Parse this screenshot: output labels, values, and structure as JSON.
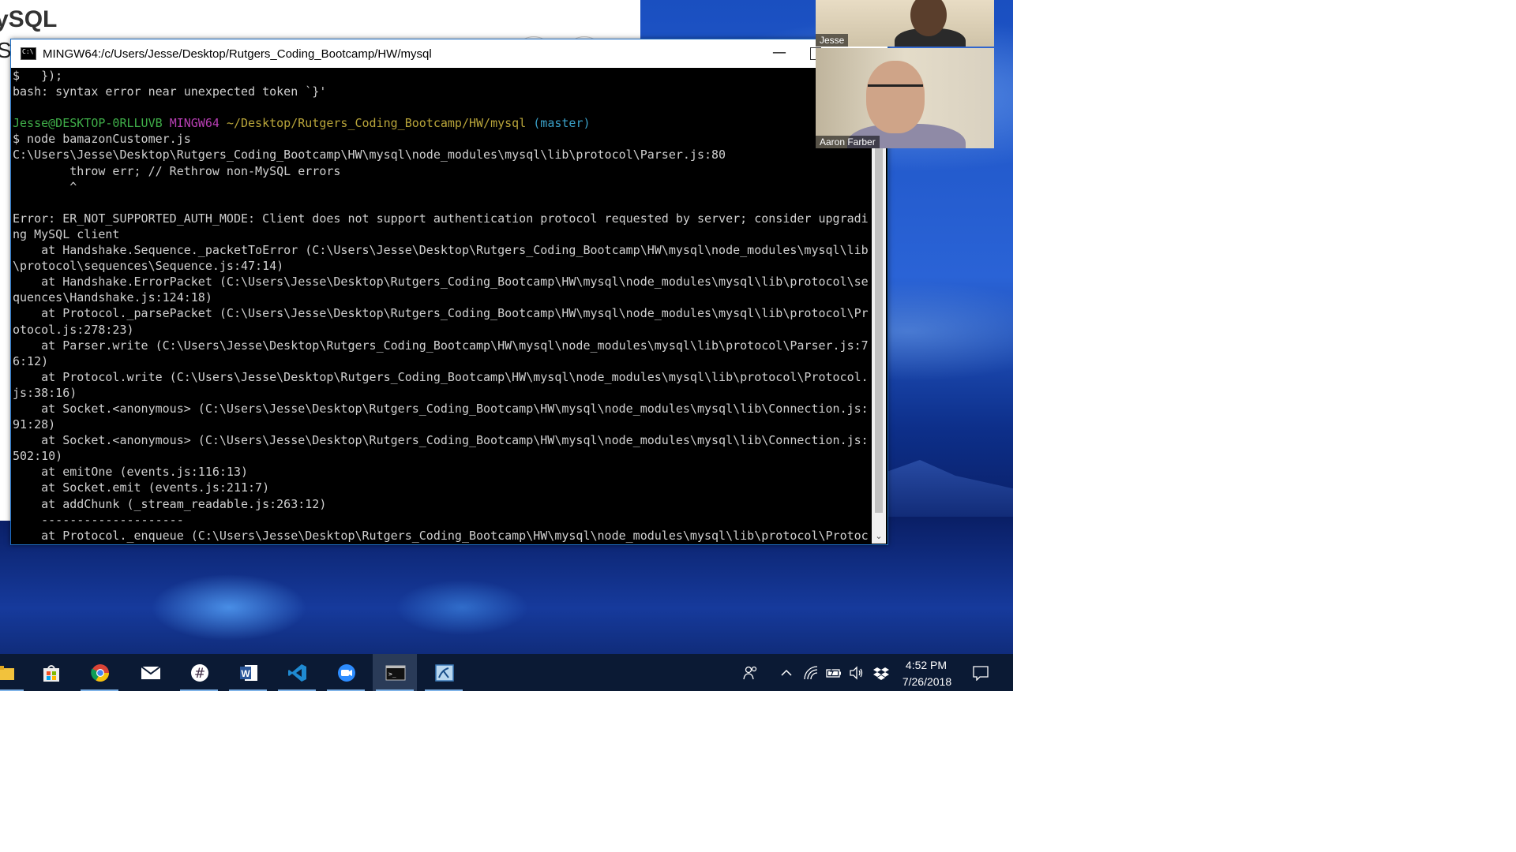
{
  "background_window": {
    "logo_text": "ySQL",
    "second_text": "S"
  },
  "terminal": {
    "title": "MINGW64:/c/Users/Jesse/Desktop/Rutgers_Coding_Bootcamp/HW/mysql",
    "minimize_glyph": "—",
    "prompt": {
      "user_host": "Jesse@DESKTOP-0RLLUVB",
      "system": "MINGW64",
      "path": "~/Desktop/Rutgers_Coding_Bootcamp/HW/mysql",
      "branch": "(master)"
    },
    "lines_before_prompt": [
      "$   });",
      "bash: syntax error near unexpected token `}'",
      ""
    ],
    "lines_after_prompt": [
      "$ node bamazonCustomer.js",
      "C:\\Users\\Jesse\\Desktop\\Rutgers_Coding_Bootcamp\\HW\\mysql\\node_modules\\mysql\\lib\\protocol\\Parser.js:80",
      "        throw err; // Rethrow non-MySQL errors",
      "        ^",
      "",
      "Error: ER_NOT_SUPPORTED_AUTH_MODE: Client does not support authentication protocol requested by server; consider upgradi",
      "ng MySQL client",
      "    at Handshake.Sequence._packetToError (C:\\Users\\Jesse\\Desktop\\Rutgers_Coding_Bootcamp\\HW\\mysql\\node_modules\\mysql\\lib",
      "\\protocol\\sequences\\Sequence.js:47:14)",
      "    at Handshake.ErrorPacket (C:\\Users\\Jesse\\Desktop\\Rutgers_Coding_Bootcamp\\HW\\mysql\\node_modules\\mysql\\lib\\protocol\\se",
      "quences\\Handshake.js:124:18)",
      "    at Protocol._parsePacket (C:\\Users\\Jesse\\Desktop\\Rutgers_Coding_Bootcamp\\HW\\mysql\\node_modules\\mysql\\lib\\protocol\\Pr",
      "otocol.js:278:23)",
      "    at Parser.write (C:\\Users\\Jesse\\Desktop\\Rutgers_Coding_Bootcamp\\HW\\mysql\\node_modules\\mysql\\lib\\protocol\\Parser.js:7",
      "6:12)",
      "    at Protocol.write (C:\\Users\\Jesse\\Desktop\\Rutgers_Coding_Bootcamp\\HW\\mysql\\node_modules\\mysql\\lib\\protocol\\Protocol.",
      "js:38:16)",
      "    at Socket.<anonymous> (C:\\Users\\Jesse\\Desktop\\Rutgers_Coding_Bootcamp\\HW\\mysql\\node_modules\\mysql\\lib\\Connection.js:",
      "91:28)",
      "    at Socket.<anonymous> (C:\\Users\\Jesse\\Desktop\\Rutgers_Coding_Bootcamp\\HW\\mysql\\node_modules\\mysql\\lib\\Connection.js:",
      "502:10)",
      "    at emitOne (events.js:116:13)",
      "    at Socket.emit (events.js:211:7)",
      "    at addChunk (_stream_readable.js:263:12)",
      "    --------------------",
      "    at Protocol._enqueue (C:\\Users\\Jesse\\Desktop\\Rutgers_Coding_Bootcamp\\HW\\mysql\\node_modules\\mysql\\lib\\protocol\\Protoc"
    ],
    "colors": {
      "background": "#000000",
      "text": "#d0d0d0",
      "user_host": "#3fae49",
      "system": "#b83fb4",
      "path": "#b9a53a",
      "branch": "#3aa0c8"
    }
  },
  "video_call": {
    "participants": [
      {
        "name": "Jesse"
      },
      {
        "name": "Aaron Farber"
      }
    ]
  },
  "taskbar": {
    "apps": [
      {
        "name": "file-explorer-icon",
        "active": false
      },
      {
        "name": "microsoft-store-icon",
        "active": false
      },
      {
        "name": "chrome-icon",
        "active": false
      },
      {
        "name": "mail-icon",
        "active": false
      },
      {
        "name": "slack-icon",
        "active": false
      },
      {
        "name": "word-icon",
        "active": false
      },
      {
        "name": "vscode-icon",
        "active": false
      },
      {
        "name": "zoom-icon",
        "active": false
      },
      {
        "name": "terminal-icon",
        "active": true
      },
      {
        "name": "mysql-workbench-icon",
        "active": false
      }
    ],
    "tray_icons": [
      "people-icon",
      "chevron-up-icon",
      "wifi-icon",
      "battery-icon",
      "volume-icon",
      "dropbox-icon",
      "action-center-icon"
    ],
    "clock": {
      "time": "4:52 PM",
      "date": "7/26/2018"
    },
    "accent_color": "#7fb3e8"
  }
}
